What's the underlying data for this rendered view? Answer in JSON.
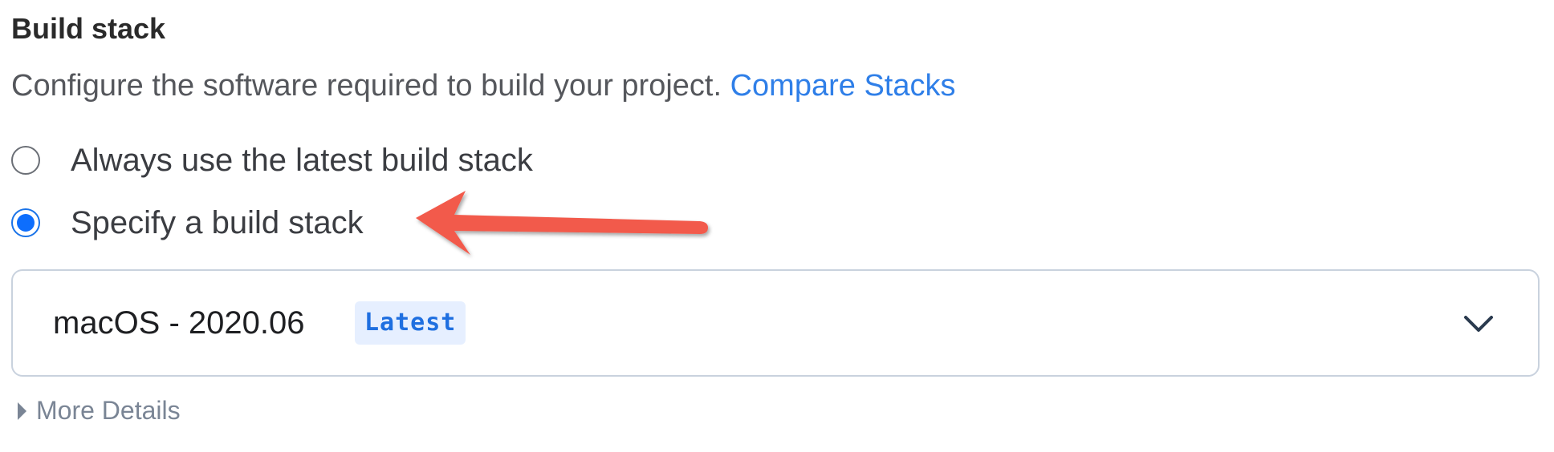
{
  "build_stack": {
    "title": "Build stack",
    "description": "Configure the software required to build your project.",
    "compare_link": "Compare Stacks",
    "options": [
      {
        "label": "Always use the latest build stack",
        "selected": false
      },
      {
        "label": "Specify a build stack",
        "selected": true
      }
    ],
    "select": {
      "value": "macOS - 2020.06",
      "badge": "Latest"
    },
    "more_details": "More Details"
  },
  "colors": {
    "link": "#2f7fe8",
    "radio_selected": "#0d6efd",
    "badge_bg": "#e6efff",
    "badge_text": "#1f6fe0",
    "annotation_arrow": "#f25a4c"
  },
  "icons": {
    "select_toggle": "chevron-down-icon",
    "details_toggle": "caret-right-icon",
    "annotation": "arrow-left-icon"
  }
}
